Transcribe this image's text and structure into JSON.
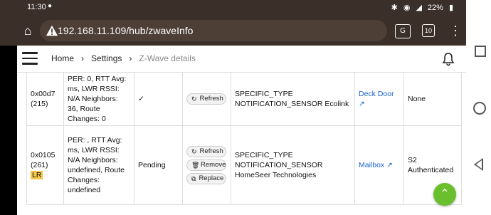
{
  "status_bar": {
    "time": "11:30",
    "extra": "●",
    "battery": "22%"
  },
  "browser": {
    "url": "192.168.11.109/hub/zwaveInfo",
    "tabs_count": "10"
  },
  "header": {
    "breadcrumbs": [
      "Home",
      "Settings",
      "Z-Wave details"
    ]
  },
  "table": {
    "rows": [
      {
        "id": "0x00d7",
        "id_dec": "(215)",
        "badge": "",
        "stats": "PER: 0, RTT Avg: ms, LWR RSSI: N/A Neighbors: 36, Route Changes: 0",
        "status": "✓",
        "actions": [
          "Refresh"
        ],
        "type": "SPECIFIC_TYPE NOTIFICATION_SENSOR Ecolink",
        "device": "Deck Door",
        "security": "None"
      },
      {
        "id": "0x0105",
        "id_dec": "(261)",
        "badge": "LR",
        "stats": "PER: , RTT Avg: ms, LWR RSSI: N/A Neighbors: undefined, Route Changes: undefined",
        "status": "Pending",
        "actions": [
          "Refresh",
          "Remove",
          "Replace"
        ],
        "type": "SPECIFIC_TYPE NOTIFICATION_SENSOR HomeSeer Technologies",
        "device": "Mailbox",
        "security": "S2 Authenticated"
      }
    ]
  },
  "colors": {
    "chrome": "#3b2f2a",
    "link": "#1a63c9",
    "badge": "#f6c54a",
    "fab": "#6abf2e"
  }
}
